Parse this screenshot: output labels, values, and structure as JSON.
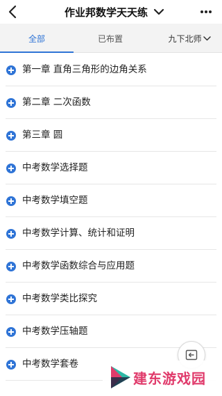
{
  "header": {
    "title": "作业邦数学天天练",
    "back_icon": "chevron-left-icon",
    "dropdown_icon": "chevron-down-icon",
    "more_icon": "more-horizontal-icon"
  },
  "tabs": [
    {
      "label": "全部",
      "active": true
    },
    {
      "label": "已布置",
      "active": false
    },
    {
      "label": "九下北师",
      "active": false
    }
  ],
  "items": [
    {
      "label": "第一章 直角三角形的边角关系"
    },
    {
      "label": "第二章 二次函数"
    },
    {
      "label": "第三章 圆"
    },
    {
      "label": "中考数学选择题"
    },
    {
      "label": "中考数学填空题"
    },
    {
      "label": "中考数学计算、统计和证明"
    },
    {
      "label": "中考数学函数综合与应用题"
    },
    {
      "label": "中考数学类比探究"
    },
    {
      "label": "中考数学压轴题"
    },
    {
      "label": "中考数学套卷"
    }
  ],
  "watermark": {
    "text": "建东游戏园"
  },
  "colors": {
    "accent": "#2f74d6",
    "watermark": "#e03a6b"
  }
}
